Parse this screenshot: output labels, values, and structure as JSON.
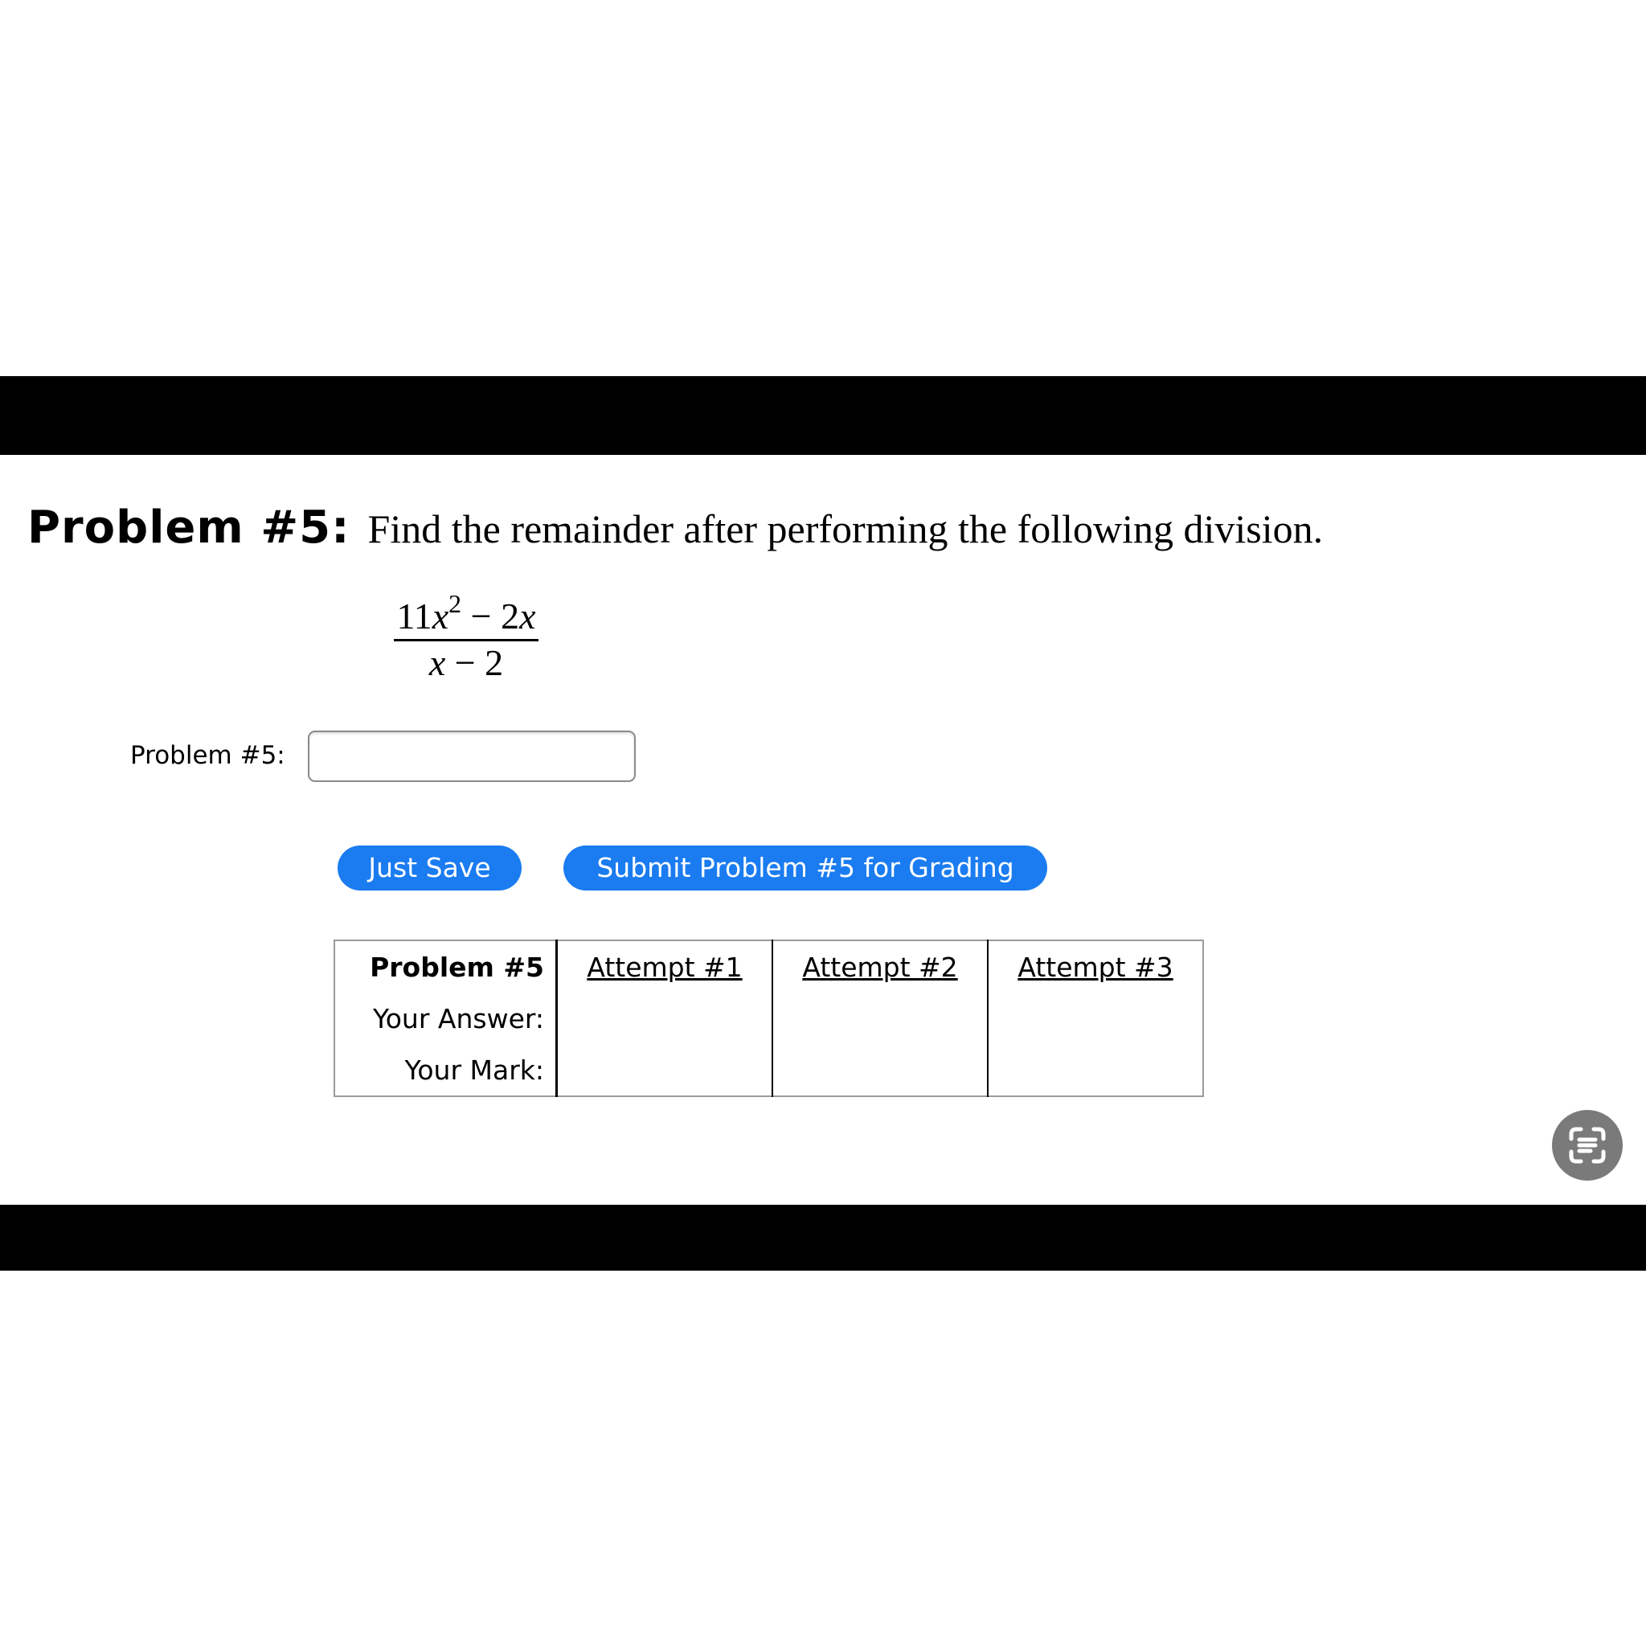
{
  "problem": {
    "heading_label": "Problem #5:",
    "prompt": "Find the remainder after performing the following division.",
    "expression": {
      "numerator_coef": "11",
      "numerator_var": "x",
      "numerator_exp": "2",
      "numerator_rest_op": " − 2",
      "numerator_rest_var": "x",
      "denominator_var": "x",
      "denominator_rest": " − 2"
    }
  },
  "answer": {
    "label": "Problem #5:",
    "value": "",
    "placeholder": ""
  },
  "buttons": {
    "save_label": "Just Save",
    "submit_label": "Submit Problem #5 for Grading"
  },
  "attempts_table": {
    "header_label": "Problem #5",
    "attempts": [
      "Attempt #1",
      "Attempt #2",
      "Attempt #3"
    ],
    "row_labels": [
      "Your Answer:",
      "Your Mark:"
    ]
  },
  "icons": {
    "fab": "scan-text-icon"
  },
  "colors": {
    "button_blue": "#1a7cf0",
    "fab_gray": "#7a7a7a"
  }
}
